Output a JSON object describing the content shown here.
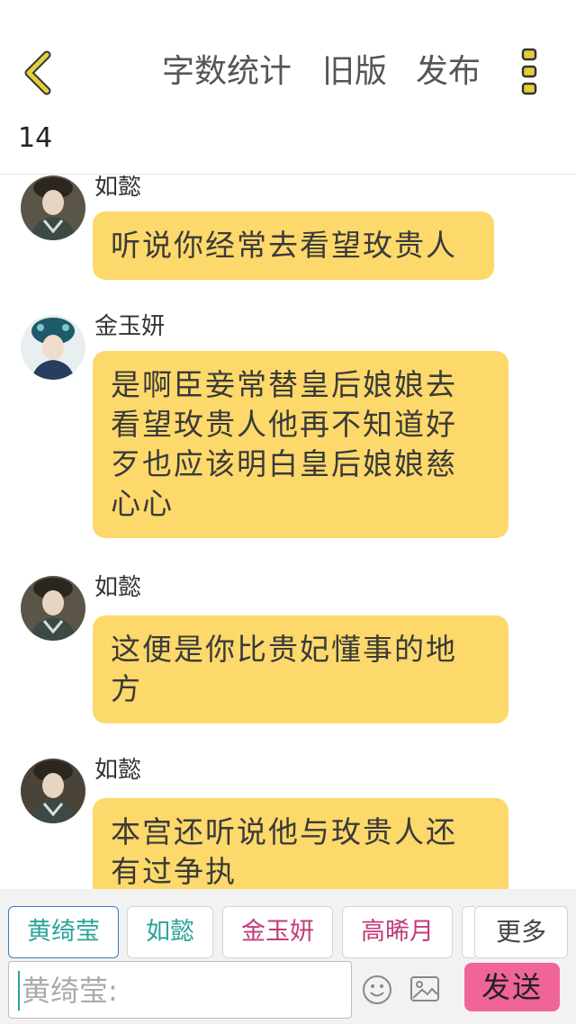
{
  "header": {
    "word_count_label": "字数统计",
    "old_version_label": "旧版",
    "publish_label": "发布",
    "count": "14"
  },
  "messages": [
    {
      "speaker": "如懿",
      "lines": [
        "听说你经常去看望玫贵人"
      ]
    },
    {
      "speaker": "金玉妍",
      "lines": [
        "是啊臣妾常替皇后娘娘去",
        "看望玫贵人他再不知道好",
        "歹也应该明白皇后娘娘慈",
        "心心"
      ]
    },
    {
      "speaker": "如懿",
      "lines": [
        "这便是你比贵妃懂事的地",
        "方"
      ]
    },
    {
      "speaker": "如懿",
      "lines": [
        "本宫还听说他与玫贵人还",
        "有过争执"
      ]
    }
  ],
  "tags": [
    "黄绮莹",
    "如懿",
    "金玉妍",
    "高晞月"
  ],
  "more_label": "更多",
  "input": {
    "value": "黄绮莹:"
  },
  "send_label": "发送",
  "colors": {
    "bubble": "#fdd96b",
    "send": "#f0649a",
    "accent": "#d9c01a"
  },
  "icons": [
    "back-chevron-icon",
    "more-dots-icon",
    "emoji-icon",
    "image-icon"
  ]
}
